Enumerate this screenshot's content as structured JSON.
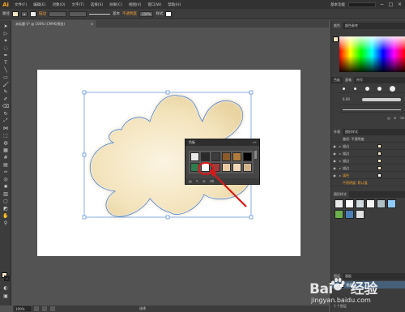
{
  "app": {
    "logo": "Ai",
    "menus": [
      "文件(F)",
      "编辑(E)",
      "对象(O)",
      "文字(T)",
      "选择(S)",
      "效果(C)",
      "视图(V)",
      "窗口(W)",
      "帮助(H)"
    ],
    "workspace": "基本功能",
    "window_controls": [
      "−",
      "□",
      "×"
    ]
  },
  "controlbar": {
    "mode_label": "路径",
    "stroke_label": "描边",
    "stroke_weight": "",
    "brush_label": "基本",
    "opacity_label": "不透明度",
    "opacity_value": "100%",
    "style_label": "样式"
  },
  "document": {
    "tab_title": "未标题-1* @ 100% (CMYK/预览)",
    "close": "×"
  },
  "swatches_popup": {
    "title": "色板",
    "swatch_colors": [
      "#e8e8e8",
      "#2a2a2a",
      "#3c3c3c",
      "#8a5a2a",
      "#b07a3a",
      "#000000",
      "#2e7d4f",
      "#ffffff",
      "#a33a3a",
      "#e6c9a0",
      "#f1d7b5",
      "#d2b48c"
    ],
    "footer": [
      "▤",
      "✎",
      "⊞",
      "⌫"
    ]
  },
  "panels": {
    "color_tabs": [
      "颜色",
      "颜色参考"
    ],
    "brush_tabs": [
      "色板",
      "画笔",
      "符号"
    ],
    "brush_size_label": "6.00",
    "appearance_tabs": [
      "外观",
      "图形样式"
    ],
    "appearance_title": "路径: 不透明度",
    "appearance_rows": [
      {
        "label": "描边",
        "swatch": "#f3e6c2"
      },
      {
        "label": "描边",
        "swatch": "#f3e6c2"
      },
      {
        "label": "描边",
        "swatch": "#f3e6c2"
      },
      {
        "label": "描边",
        "swatch": "#f3e6c2"
      },
      {
        "label": "填色",
        "swatch": "#ffffff"
      }
    ],
    "opacity_row": "不透明度: 默认值",
    "graphic_styles_title": "图形样式",
    "graphic_style_colors": [
      "#e8e8e8",
      "#ffffff",
      "#cfd8dc",
      "#f5f5f5",
      "#b0bec5",
      "#90caf9",
      "#6ab04c",
      "#4a7fb5",
      "#e0e0e0"
    ],
    "layers_tabs": [
      "图层",
      "画板"
    ],
    "layer_name": "图层 1",
    "layer_count": "1 个图层"
  },
  "statusbar": {
    "zoom": "100%",
    "tool": "选择"
  },
  "watermark": {
    "brand": "Bai",
    "brand_cn": "经验",
    "url": "jingyan.baidu.com"
  },
  "colors": {
    "blob_fill": "#f3e6c2",
    "selection": "#3a78d8",
    "arrow": "#d81818"
  }
}
